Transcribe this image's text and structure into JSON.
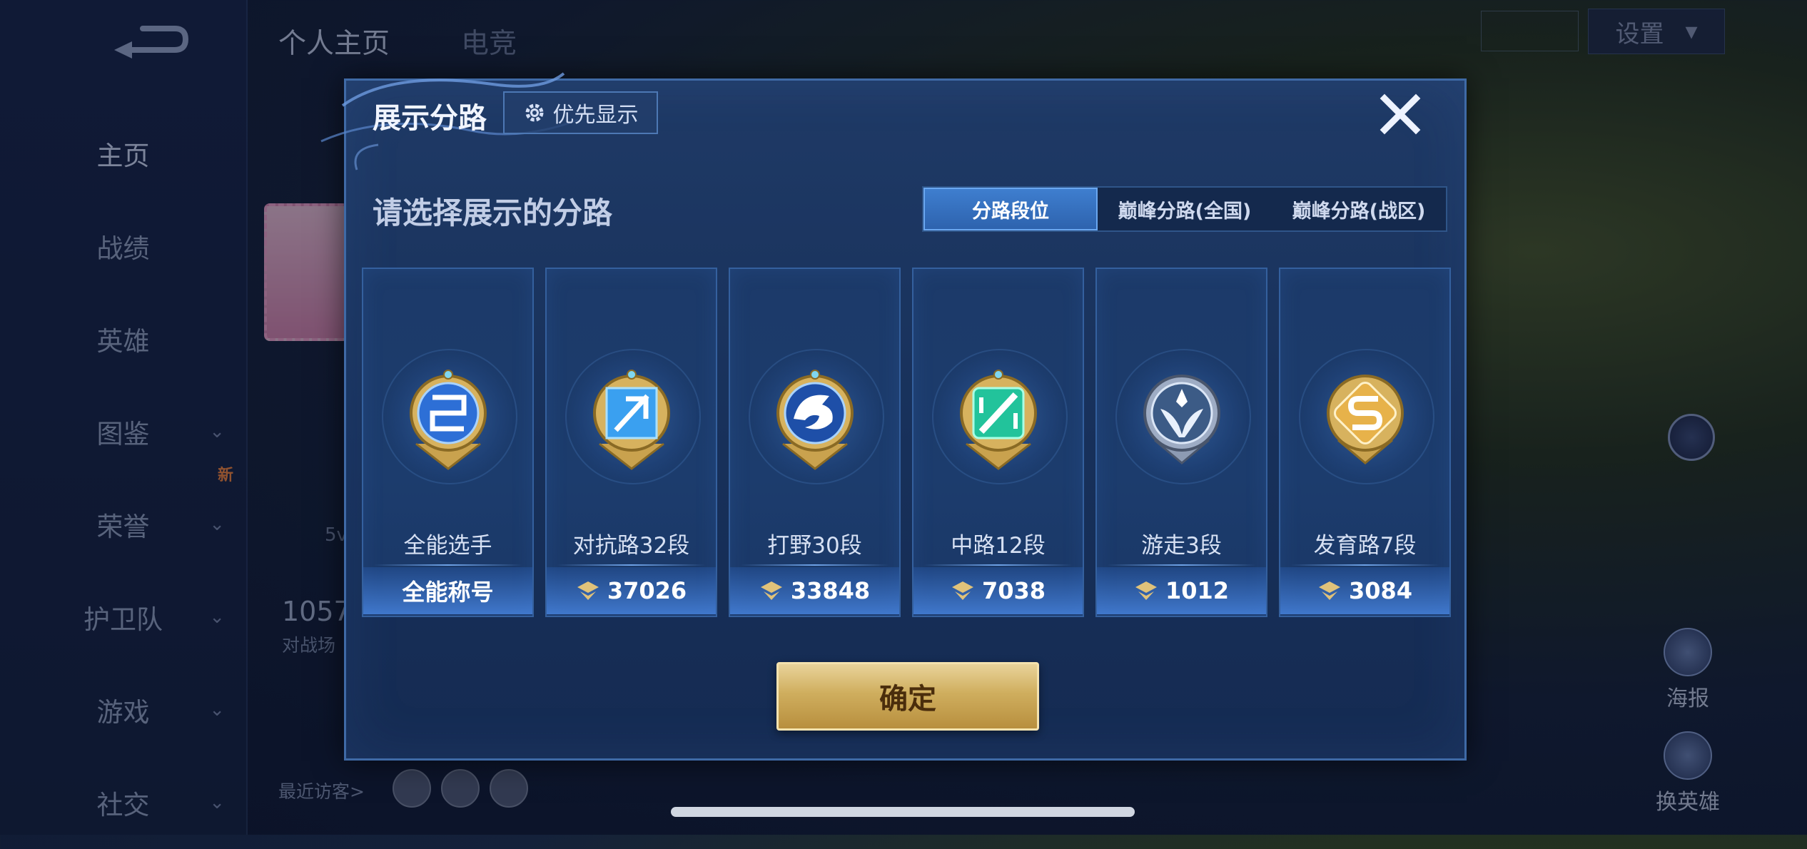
{
  "background": {
    "nav": [
      {
        "label": "主页",
        "chevron": false,
        "active": true
      },
      {
        "label": "战绩",
        "chevron": false
      },
      {
        "label": "英雄",
        "chevron": false
      },
      {
        "label": "图鉴",
        "chevron": true
      },
      {
        "label": "荣誉",
        "chevron": true,
        "badge": "新"
      },
      {
        "label": "护卫队",
        "chevron": true
      },
      {
        "label": "游戏",
        "chevron": true
      },
      {
        "label": "社交",
        "chevron": true
      }
    ],
    "top_tabs": [
      "个人主页",
      "电竞"
    ],
    "settings_label": "设置",
    "number_text": "1057",
    "subtitle_text": "对战场",
    "small_text": "5v",
    "visitors_label": "最近访客>",
    "poster_label": "海报",
    "change_hero_label": "换英雄"
  },
  "modal": {
    "title": "展示分路",
    "priority_label": "优先显示",
    "prompt": "请选择展示的分路",
    "tabs": [
      "分路段位",
      "巅峰分路(全国)",
      "巅峰分路(战区)"
    ],
    "active_tab": 0,
    "cards": [
      {
        "label": "全能选手",
        "footer": "全能称号",
        "has_points": false,
        "emblem": "allround-emblem-icon",
        "accent": "#4fa6ff"
      },
      {
        "label": "对抗路32段",
        "footer": "37026",
        "has_points": true,
        "emblem": "clash-lane-emblem-icon",
        "accent": "#4fb8ff"
      },
      {
        "label": "打野30段",
        "footer": "33848",
        "has_points": true,
        "emblem": "jungle-emblem-icon",
        "accent": "#3f7fe0"
      },
      {
        "label": "中路12段",
        "footer": "7038",
        "has_points": true,
        "emblem": "mid-lane-emblem-icon",
        "accent": "#2ed1a6"
      },
      {
        "label": "游走3段",
        "footer": "1012",
        "has_points": true,
        "emblem": "roam-emblem-icon",
        "accent": "#b9c9e0"
      },
      {
        "label": "发育路7段",
        "footer": "3084",
        "has_points": true,
        "emblem": "farm-lane-emblem-icon",
        "accent": "#e8b64a"
      }
    ],
    "confirm_label": "确定"
  },
  "colors": {
    "gold": "#d2ab58",
    "active_tab": "#3f7fd0",
    "panel": "#1f3a66"
  }
}
